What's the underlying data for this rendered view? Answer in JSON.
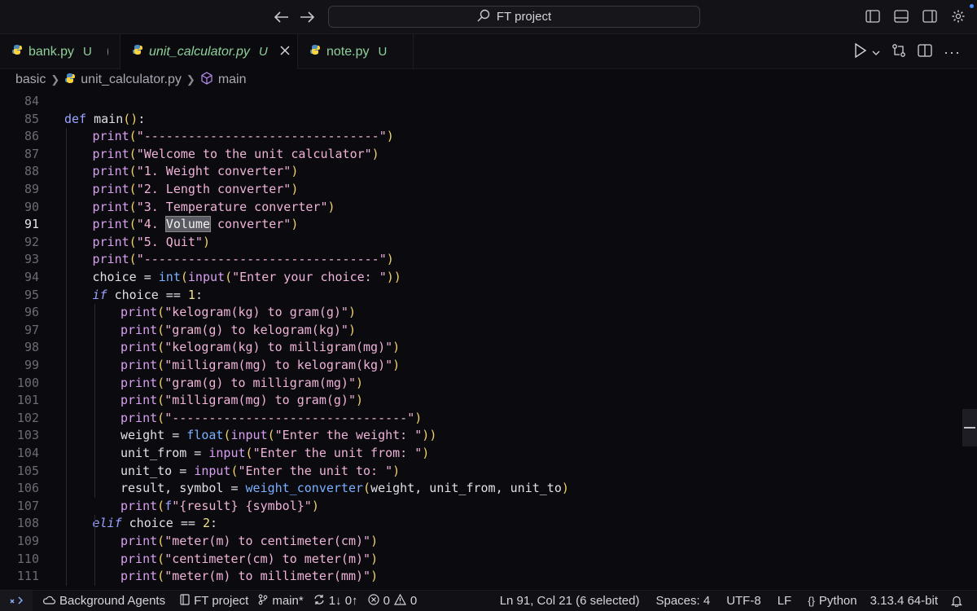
{
  "titlebar": {
    "search_label": "FT project",
    "back_icon": "arrow-left-icon",
    "forward_icon": "arrow-right-icon"
  },
  "tabs": [
    {
      "label": "bank.py",
      "flag": "U",
      "state": "dirty",
      "active": false
    },
    {
      "label": "unit_calculator.py",
      "flag": "U",
      "state": "close",
      "active": true
    },
    {
      "label": "note.py",
      "flag": "U",
      "state": "",
      "active": false
    }
  ],
  "breadcrumb": {
    "folder": "basic",
    "file": "unit_calculator.py",
    "symbol": "main"
  },
  "editor": {
    "current_line": "91",
    "lines": [
      {
        "n": "84",
        "indent": 0,
        "text": ""
      },
      {
        "n": "85",
        "indent": 0,
        "text": "def main():"
      },
      {
        "n": "86",
        "indent": 1,
        "text": "print(\"--------------------------------\")"
      },
      {
        "n": "87",
        "indent": 1,
        "text": "print(\"Welcome to the unit calculator\")"
      },
      {
        "n": "88",
        "indent": 1,
        "text": "print(\"1. Weight converter\")"
      },
      {
        "n": "89",
        "indent": 1,
        "text": "print(\"2. Length converter\")"
      },
      {
        "n": "90",
        "indent": 1,
        "text": "print(\"3. Temperature converter\")"
      },
      {
        "n": "91",
        "indent": 1,
        "text": "print(\"4. Volume converter\")"
      },
      {
        "n": "92",
        "indent": 1,
        "text": "print(\"5. Quit\")"
      },
      {
        "n": "93",
        "indent": 1,
        "text": "print(\"--------------------------------\")"
      },
      {
        "n": "94",
        "indent": 1,
        "text": "choice = int(input(\"Enter your choice: \"))"
      },
      {
        "n": "95",
        "indent": 1,
        "text": "if choice == 1:"
      },
      {
        "n": "96",
        "indent": 2,
        "text": "print(\"kelogram(kg) to gram(g)\")"
      },
      {
        "n": "97",
        "indent": 2,
        "text": "print(\"gram(g) to kelogram(kg)\")"
      },
      {
        "n": "98",
        "indent": 2,
        "text": "print(\"kelogram(kg) to milligram(mg)\")"
      },
      {
        "n": "99",
        "indent": 2,
        "text": "print(\"milligram(mg) to kelogram(kg)\")"
      },
      {
        "n": "100",
        "indent": 2,
        "text": "print(\"gram(g) to milligram(mg)\")"
      },
      {
        "n": "101",
        "indent": 2,
        "text": "print(\"milligram(mg) to gram(g)\")"
      },
      {
        "n": "102",
        "indent": 2,
        "text": "print(\"--------------------------------\")"
      },
      {
        "n": "103",
        "indent": 2,
        "text": "weight = float(input(\"Enter the weight: \"))"
      },
      {
        "n": "104",
        "indent": 2,
        "text": "unit_from = input(\"Enter the unit from: \")"
      },
      {
        "n": "105",
        "indent": 2,
        "text": "unit_to = input(\"Enter the unit to: \")"
      },
      {
        "n": "106",
        "indent": 2,
        "text": "result, symbol = weight_converter(weight, unit_from, unit_to)"
      },
      {
        "n": "107",
        "indent": 2,
        "text": "print(f\"{result} {symbol}\")"
      },
      {
        "n": "108",
        "indent": 1,
        "text": "elif choice == 2:"
      },
      {
        "n": "109",
        "indent": 2,
        "text": "print(\"meter(m) to centimeter(cm)\")"
      },
      {
        "n": "110",
        "indent": 2,
        "text": "print(\"centimeter(cm) to meter(m)\")"
      },
      {
        "n": "111",
        "indent": 2,
        "text": "print(\"meter(m) to millimeter(mm)\")"
      }
    ],
    "selection": {
      "line": "91",
      "word": "Volume"
    }
  },
  "statusbar": {
    "background_agents": "Background Agents",
    "project": "FT project",
    "branch": "main*",
    "sync": "1↓ 0↑",
    "errors": "0",
    "warnings": "0",
    "cursor": "Ln 91, Col 21 (6 selected)",
    "spaces": "Spaces: 4",
    "encoding": "UTF-8",
    "eol": "LF",
    "language": "Python",
    "interpreter": "3.13.4 64-bit"
  },
  "colors": {
    "accent": "#4c8dff",
    "keyword": "#9aa4ff",
    "function": "#d9a0f0",
    "string": "#f0b3d8",
    "number": "#f2e28a",
    "modified_tab": "#8fd19a"
  }
}
